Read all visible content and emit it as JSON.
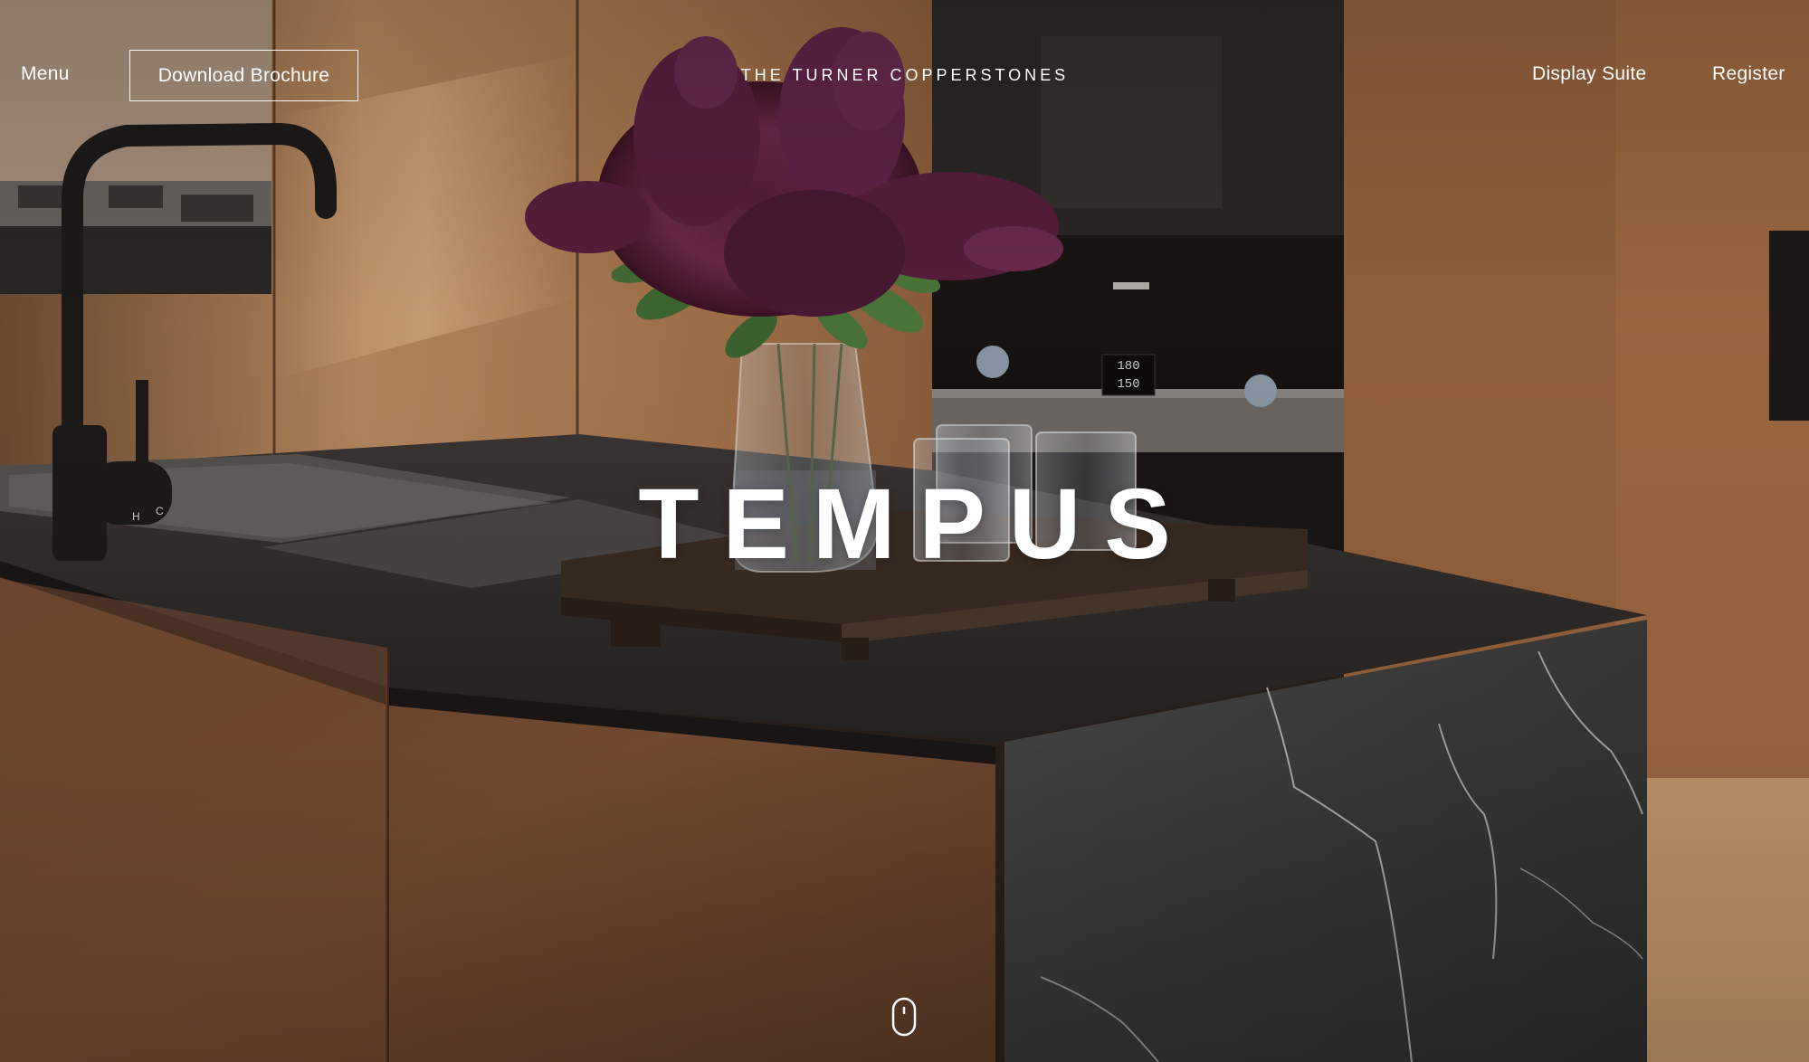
{
  "header": {
    "menu_label": "Menu",
    "brochure_label": "Download Brochure",
    "brand_name": "THE TURNER COPPERSTONES",
    "display_suite_label": "Display Suite",
    "register_label": "Register"
  },
  "hero": {
    "title": "TEMPUS",
    "background_description_icon": "kitchen-photo",
    "scroll_icon": "mouse-scroll-icon"
  },
  "oven_display": {
    "line1": "180",
    "line2": "150"
  },
  "sink_tap_labels": {
    "hot": "H",
    "cold": "C"
  },
  "colors": {
    "text": "#ffffff",
    "wood": "#8a5a38",
    "stone": "#3a3a3a"
  }
}
